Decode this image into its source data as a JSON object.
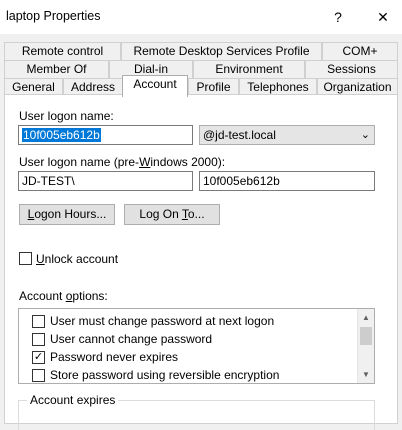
{
  "window": {
    "title": "laptop Properties",
    "help_glyph": "?",
    "close_glyph": "✕"
  },
  "tabs": {
    "row1": [
      "Remote control",
      "Remote Desktop Services Profile",
      "COM+"
    ],
    "row2": [
      "Member Of",
      "Dial-in",
      "Environment",
      "Sessions"
    ],
    "row3": [
      "General",
      "Address",
      "Account",
      "Profile",
      "Telephones",
      "Organization"
    ],
    "active": "Account"
  },
  "account": {
    "logon_name_label": "User logon name:",
    "logon_name_value": "10f005eb612b",
    "domain_value": "@jd-test.local",
    "pre2000_label_before": "User logon name (pre-",
    "pre2000_label_underlined": "W",
    "pre2000_label_after": "indows 2000):",
    "pre2000_domain": "JD-TEST\\",
    "pre2000_name": "10f005eb612b",
    "logon_hours_underlined": "L",
    "logon_hours_rest": "ogon Hours...",
    "logon_to_before": "Log On ",
    "logon_to_underlined": "T",
    "logon_to_after": "o...",
    "unlock_underlined": "U",
    "unlock_rest": "nlock account",
    "options_label_before": "Account ",
    "options_label_underlined": "o",
    "options_label_after": "ptions:",
    "options": [
      {
        "label": "User must change password at next logon",
        "checked": false,
        "mark": ""
      },
      {
        "label": "User cannot change password",
        "checked": false,
        "mark": ""
      },
      {
        "label": "Password never expires",
        "checked": true,
        "mark": "✓"
      },
      {
        "label": "Store password using reversible encryption",
        "checked": false,
        "mark": ""
      }
    ],
    "expires_label": "Account expires"
  },
  "colors": {
    "selection": "#0078d7",
    "background": "#f0f0f0"
  }
}
